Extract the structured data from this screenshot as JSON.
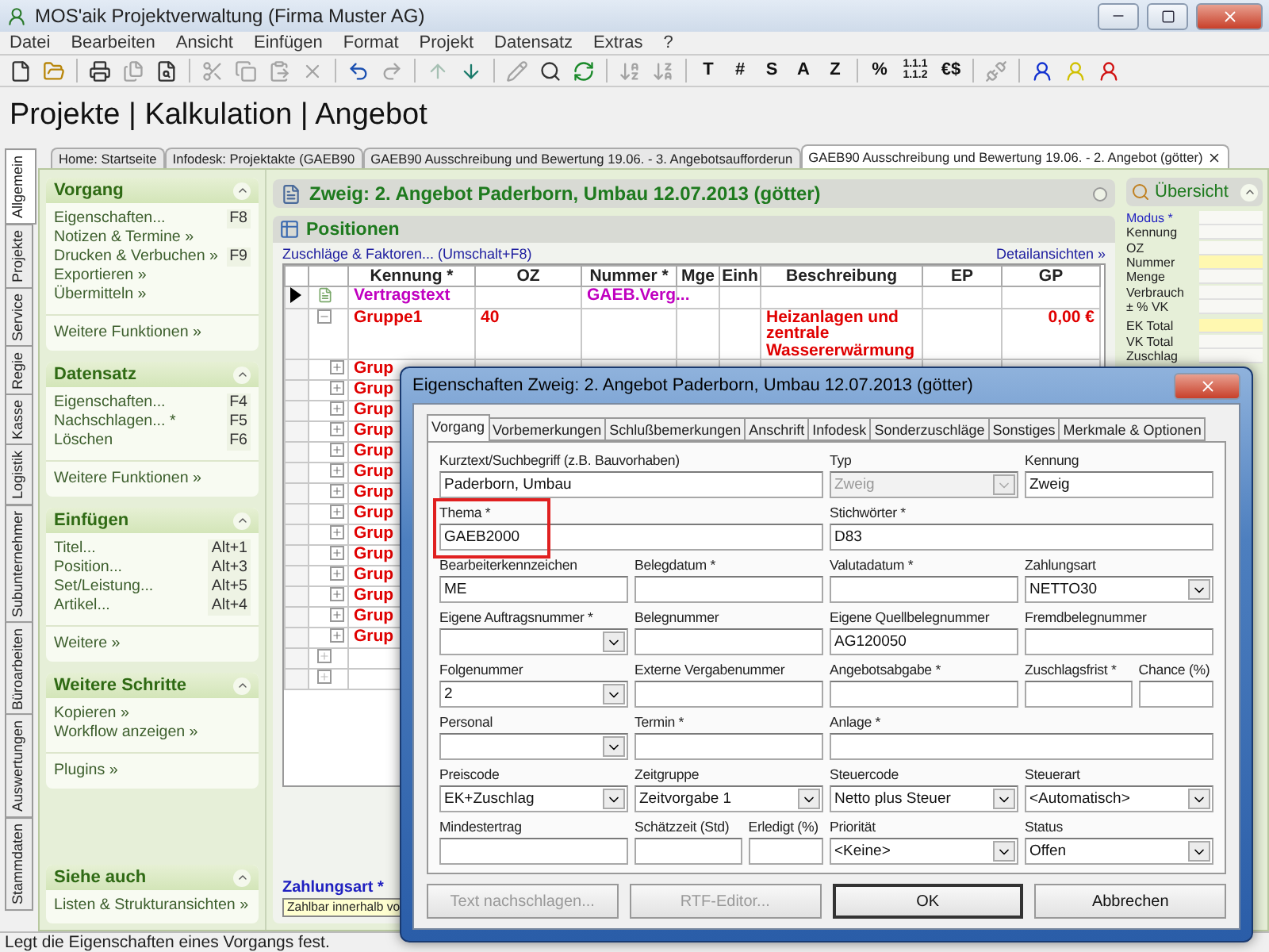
{
  "window": {
    "title": "MOS'aik Projektverwaltung (Firma Muster AG)"
  },
  "menu": [
    "Datei",
    "Bearbeiten",
    "Ansicht",
    "Einfügen",
    "Format",
    "Projekt",
    "Datensatz",
    "Extras",
    "?"
  ],
  "toolbar": [
    {
      "kind": "icon",
      "disabled": false
    },
    {
      "kind": "icon",
      "disabled": false
    },
    {
      "kind": "separator"
    },
    {
      "kind": "icon",
      "disabled": false
    },
    {
      "kind": "icon",
      "disabled": true
    },
    {
      "kind": "icon",
      "disabled": false
    },
    {
      "kind": "separator"
    },
    {
      "kind": "icon",
      "disabled": true
    },
    {
      "kind": "icon",
      "disabled": true
    },
    {
      "kind": "icon",
      "disabled": true
    },
    {
      "kind": "icon",
      "disabled": true
    },
    {
      "kind": "separator"
    },
    {
      "kind": "icon",
      "disabled": false
    },
    {
      "kind": "icon",
      "disabled": true
    },
    {
      "kind": "separator"
    },
    {
      "kind": "icon",
      "disabled": true
    },
    {
      "kind": "icon",
      "disabled": false
    },
    {
      "kind": "separator"
    },
    {
      "kind": "icon",
      "disabled": true
    },
    {
      "kind": "icon",
      "disabled": false
    },
    {
      "kind": "icon",
      "disabled": false
    },
    {
      "kind": "separator"
    },
    {
      "kind": "icon",
      "disabled": true
    },
    {
      "kind": "icon",
      "disabled": true
    },
    {
      "kind": "separator"
    },
    {
      "kind": "text",
      "label": "T"
    },
    {
      "kind": "text",
      "label": "#"
    },
    {
      "kind": "text",
      "label": "S"
    },
    {
      "kind": "text",
      "label": "A"
    },
    {
      "kind": "text",
      "label": "Z"
    },
    {
      "kind": "separator"
    },
    {
      "kind": "text",
      "label": "%"
    },
    {
      "kind": "text",
      "label": "1.1.1 1.1.2"
    },
    {
      "kind": "text",
      "label": "€$"
    },
    {
      "kind": "separator"
    },
    {
      "kind": "icon",
      "disabled": true
    },
    {
      "kind": "separator"
    },
    {
      "kind": "icon",
      "disabled": false
    },
    {
      "kind": "icon",
      "disabled": false
    },
    {
      "kind": "icon",
      "disabled": false
    }
  ],
  "heading": "Projekte | Kalkulation | Angebot",
  "vertical_tabs": [
    {
      "label": "Allgemein",
      "selected": true
    },
    {
      "label": "Projekte",
      "selected": false
    },
    {
      "label": "Service",
      "selected": false
    },
    {
      "label": "Regie",
      "selected": false
    },
    {
      "label": "Kasse",
      "selected": false
    },
    {
      "label": "Logistik",
      "selected": false
    },
    {
      "label": "Subunternehmer",
      "selected": false
    },
    {
      "label": "Büroarbeiten",
      "selected": false
    },
    {
      "label": "Auswertungen",
      "selected": false
    },
    {
      "label": "Stammdaten",
      "selected": false
    }
  ],
  "doc_tabs": [
    {
      "label": "Home: Startseite",
      "selected": false
    },
    {
      "label": "Infodesk: Projektakte (GAEB90",
      "selected": false
    },
    {
      "label": "GAEB90 Ausschreibung und Bewertung 19.06. - 3. Angebotsaufforderun",
      "selected": false
    },
    {
      "label": "GAEB90 Ausschreibung und Bewertung 19.06. - 2. Angebot (götter)",
      "selected": true
    }
  ],
  "sidebar": [
    {
      "title": "Vorgang",
      "items": [
        {
          "label": "Eigenschaften...",
          "shortcut": "F8"
        },
        {
          "label": "Notizen & Termine »"
        },
        {
          "label": "Drucken & Verbuchen »",
          "shortcut": "F9"
        },
        {
          "label": "Exportieren »"
        },
        {
          "label": "Übermitteln »"
        }
      ],
      "footer": [
        "Weitere Funktionen »"
      ]
    },
    {
      "title": "Datensatz",
      "items": [
        {
          "label": "Eigenschaften...",
          "shortcut": "F4"
        },
        {
          "label": "Nachschlagen... *",
          "shortcut": "F5"
        },
        {
          "label": "Löschen",
          "shortcut": "F6"
        }
      ],
      "footer": [
        "Weitere Funktionen »"
      ]
    },
    {
      "title": "Einfügen",
      "items": [
        {
          "label": "Titel...",
          "shortcut": "Alt+1"
        },
        {
          "label": "Position...",
          "shortcut": "Alt+3"
        },
        {
          "label": "Set/Leistung...",
          "shortcut": "Alt+5"
        },
        {
          "label": "Artikel...",
          "shortcut": "Alt+4"
        }
      ],
      "footer": [
        "Weitere »"
      ]
    },
    {
      "title": "Weitere Schritte",
      "items": [
        {
          "label": "Kopieren »"
        },
        {
          "label": "Workflow anzeigen »"
        }
      ],
      "footer": [
        "Plugins »"
      ]
    },
    {
      "title": "Siehe auch",
      "items": [
        {
          "label": "Listen & Strukturansichten »"
        }
      ]
    }
  ],
  "document": {
    "title": "Zweig: 2. Angebot Paderborn, Umbau 12.07.2013 (götter)",
    "panel_title": "Positionen",
    "link_left": "Zuschläge & Faktoren... (Umschalt+F8)",
    "link_right": "Detailansichten »",
    "table": {
      "columns": [
        "Kennung *",
        "OZ",
        "Nummer *",
        "Mge",
        "Einh",
        "Beschreibung",
        "EP",
        "GP"
      ],
      "rows": [
        {
          "kind": "contract",
          "selected": true,
          "kennung": "Vertragstext",
          "nummer": "GAEB.Verg..."
        },
        {
          "kind": "group",
          "selected": false,
          "expanded": true,
          "kennung": "Gruppe1",
          "oz": "40",
          "beschreibung": "Heizanlagen und zentrale Wassererwärmung",
          "gp": "0,00 €",
          "children": [
            {
              "kind": "group",
              "selected": false,
              "expanded": false,
              "kennung": "Grup"
            },
            {
              "kind": "group",
              "selected": false,
              "expanded": false,
              "kennung": "Grup"
            },
            {
              "kind": "group",
              "selected": false,
              "expanded": false,
              "kennung": "Grup"
            },
            {
              "kind": "group",
              "selected": false,
              "expanded": false,
              "kennung": "Grup"
            },
            {
              "kind": "group",
              "selected": false,
              "expanded": false,
              "kennung": "Grup"
            },
            {
              "kind": "group",
              "selected": false,
              "expanded": false,
              "kennung": "Grup"
            },
            {
              "kind": "group",
              "selected": false,
              "expanded": false,
              "kennung": "Grup"
            },
            {
              "kind": "group",
              "selected": false,
              "expanded": false,
              "kennung": "Grup"
            },
            {
              "kind": "group",
              "selected": false,
              "expanded": false,
              "kennung": "Grup"
            },
            {
              "kind": "group",
              "selected": false,
              "expanded": false,
              "kennung": "Grup"
            },
            {
              "kind": "group",
              "selected": false,
              "expanded": false,
              "kennung": "Grup"
            },
            {
              "kind": "group",
              "selected": false,
              "expanded": false,
              "kennung": "Grup"
            },
            {
              "kind": "group",
              "selected": false,
              "expanded": false,
              "kennung": "Grup"
            },
            {
              "kind": "group",
              "selected": false,
              "expanded": false,
              "kennung": "Grup"
            }
          ]
        },
        {
          "kind": "empty",
          "selected": false,
          "expanded": false
        },
        {
          "kind": "empty",
          "selected": false,
          "expanded": false
        }
      ]
    },
    "payment": {
      "label": "Zahlungsart *",
      "value": "Zahlbar innerhalb vo"
    }
  },
  "overview": {
    "title": "Übersicht",
    "groups": [
      [
        {
          "label": "Modus *",
          "kind": "link",
          "highlighted": false
        },
        {
          "label": "Kennung",
          "kind": "plain",
          "highlighted": false
        },
        {
          "label": "OZ",
          "kind": "plain",
          "highlighted": false
        },
        {
          "label": "Nummer",
          "kind": "plain",
          "highlighted": true
        },
        {
          "label": "Menge",
          "kind": "plain",
          "highlighted": false
        },
        {
          "label": "Verbrauch",
          "kind": "plain",
          "highlighted": false
        },
        {
          "label": "± % VK",
          "kind": "plain",
          "highlighted": false
        }
      ],
      [
        {
          "label": "EK Total",
          "kind": "plain",
          "highlighted": true
        },
        {
          "label": "VK Total",
          "kind": "plain",
          "highlighted": false
        },
        {
          "label": "Zuschlag",
          "kind": "plain",
          "highlighted": false
        }
      ]
    ]
  },
  "dialog": {
    "title": "Eigenschaften Zweig: 2. Angebot Paderborn, Umbau 12.07.2013 (götter)",
    "tabs": [
      {
        "label": "Vorgang",
        "selected": true
      },
      {
        "label": "Vorbemerkungen",
        "selected": false
      },
      {
        "label": "Schlußbemerkungen",
        "selected": false
      },
      {
        "label": "Anschrift",
        "selected": false
      },
      {
        "label": "Infodesk",
        "selected": false
      },
      {
        "label": "Sonderzuschläge",
        "selected": false
      },
      {
        "label": "Sonstiges",
        "selected": false
      },
      {
        "label": "Merkmale & Optionen",
        "selected": false
      }
    ],
    "fields": [
      {
        "label": "Kurztext/Suchbegriff (z.B. Bauvorhaben)",
        "kind": "text",
        "value": "Paderborn, Umbau",
        "disabled": false,
        "highlighted": false
      },
      {
        "label": "Typ",
        "kind": "select",
        "value": "Zweig",
        "disabled": true,
        "highlighted": false
      },
      {
        "label": "Kennung",
        "kind": "text",
        "value": "Zweig",
        "disabled": false,
        "highlighted": false
      },
      {
        "label": "Thema *",
        "kind": "text",
        "value": "GAEB2000",
        "disabled": false,
        "highlighted": true
      },
      {
        "label": "Stichwörter *",
        "kind": "text",
        "value": "D83",
        "disabled": false,
        "highlighted": false
      },
      {
        "label": "Bearbeiterkennzeichen",
        "kind": "text",
        "value": "ME",
        "disabled": false,
        "highlighted": false
      },
      {
        "label": "Belegdatum *",
        "kind": "text",
        "disabled": false,
        "highlighted": false
      },
      {
        "label": "Valutadatum *",
        "kind": "text",
        "disabled": false,
        "highlighted": false
      },
      {
        "label": "Zahlungsart",
        "kind": "select",
        "value": "NETTO30",
        "disabled": false,
        "highlighted": false
      },
      {
        "label": "Eigene Auftragsnummer *",
        "kind": "select",
        "disabled": false,
        "highlighted": false
      },
      {
        "label": "Belegnummer",
        "kind": "text",
        "disabled": false,
        "highlighted": false
      },
      {
        "label": "Eigene Quellbelegnummer",
        "kind": "text",
        "value": "AG120050",
        "disabled": false,
        "highlighted": false
      },
      {
        "label": "Fremdbelegnummer",
        "kind": "text",
        "disabled": false,
        "highlighted": false
      },
      {
        "label": "Folgenummer",
        "kind": "select",
        "value": "2",
        "disabled": false,
        "highlighted": false
      },
      {
        "label": "Externe Vergabenummer",
        "kind": "text",
        "disabled": false,
        "highlighted": false
      },
      {
        "label": "Angebotsabgabe *",
        "kind": "text",
        "disabled": false,
        "highlighted": false
      },
      {
        "label": "Zuschlagsfrist *",
        "kind": "text",
        "disabled": false,
        "highlighted": false
      },
      {
        "label": "Chance (%)",
        "kind": "text",
        "disabled": false,
        "highlighted": false
      },
      {
        "label": "Personal",
        "kind": "select",
        "disabled": false,
        "highlighted": false
      },
      {
        "label": "Termin *",
        "kind": "text",
        "disabled": false,
        "highlighted": false
      },
      {
        "label": "Anlage *",
        "kind": "text",
        "disabled": false,
        "highlighted": false
      },
      {
        "label": "Preiscode",
        "kind": "select",
        "value": "EK+Zuschlag",
        "disabled": false,
        "highlighted": false
      },
      {
        "label": "Zeitgruppe",
        "kind": "select",
        "value": "Zeitvorgabe 1",
        "disabled": false,
        "highlighted": false
      },
      {
        "label": "Steuercode",
        "kind": "select",
        "value": "Netto plus Steuer",
        "disabled": false,
        "highlighted": false
      },
      {
        "label": "Steuerart",
        "kind": "select",
        "value": "<Automatisch>",
        "disabled": false,
        "highlighted": false
      },
      {
        "label": "Mindestertrag",
        "kind": "text",
        "disabled": false,
        "highlighted": false
      },
      {
        "label": "Schätzzeit (Std)",
        "kind": "text",
        "disabled": false,
        "highlighted": false
      },
      {
        "label": "Erledigt (%)",
        "kind": "text",
        "disabled": false,
        "highlighted": false
      },
      {
        "label": "Priorität",
        "kind": "select",
        "value": "<Keine>",
        "disabled": false,
        "highlighted": false
      },
      {
        "label": "Status",
        "kind": "select",
        "value": "Offen",
        "disabled": false,
        "highlighted": false
      }
    ],
    "buttons": [
      {
        "label": "Text nachschlagen...",
        "disabled": true,
        "default": false
      },
      {
        "label": "RTF-Editor...",
        "disabled": true,
        "default": false
      },
      {
        "label": "OK",
        "disabled": false,
        "default": true
      },
      {
        "label": "Abbrechen",
        "disabled": false,
        "default": false
      }
    ]
  },
  "status_bar": "Legt die Eigenschaften eines Vorgangs fest."
}
